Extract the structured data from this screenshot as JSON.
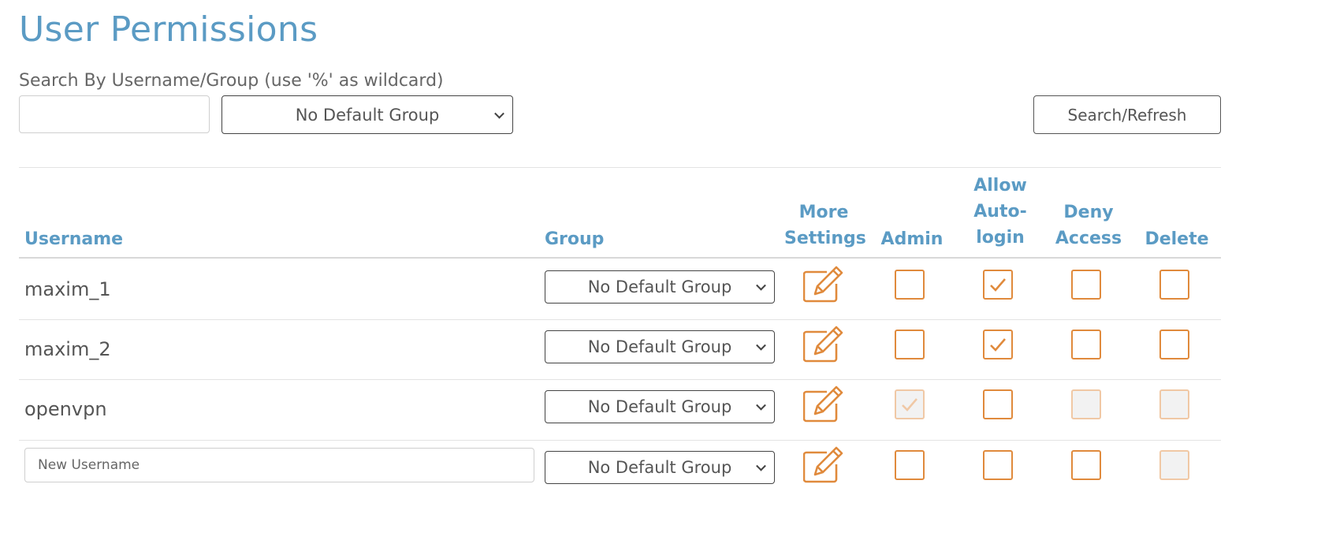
{
  "page": {
    "title": "User Permissions",
    "search_label": "Search By Username/Group (use '%' as wildcard)",
    "search_value": "",
    "group_filter": "No Default Group",
    "refresh_button": "Search/Refresh"
  },
  "table": {
    "headers": {
      "username": "Username",
      "group": "Group",
      "more_settings_1": "More",
      "more_settings_2": "Settings",
      "admin": "Admin",
      "autologin_1": "Allow",
      "autologin_2": "Auto-",
      "autologin_3": "login",
      "deny_1": "Deny",
      "deny_2": "Access",
      "delete": "Delete"
    },
    "rows": [
      {
        "username": "maxim_1",
        "group": "No Default Group",
        "admin": false,
        "autologin": true,
        "deny": false,
        "delete": false
      },
      {
        "username": "maxim_2",
        "group": "No Default Group",
        "admin": false,
        "autologin": true,
        "deny": false,
        "delete": false
      },
      {
        "username": "openvpn",
        "group": "No Default Group",
        "admin": true,
        "autologin": false,
        "deny": false,
        "delete": false
      }
    ],
    "new_row": {
      "placeholder": "New Username",
      "group": "No Default Group"
    }
  },
  "colors": {
    "accent_blue": "#5b9bc4",
    "accent_orange": "#e08a3c",
    "disabled_orange": "#f0c8a5"
  },
  "icons": {
    "edit": "pencil-square-icon",
    "check": "checkmark-icon"
  }
}
